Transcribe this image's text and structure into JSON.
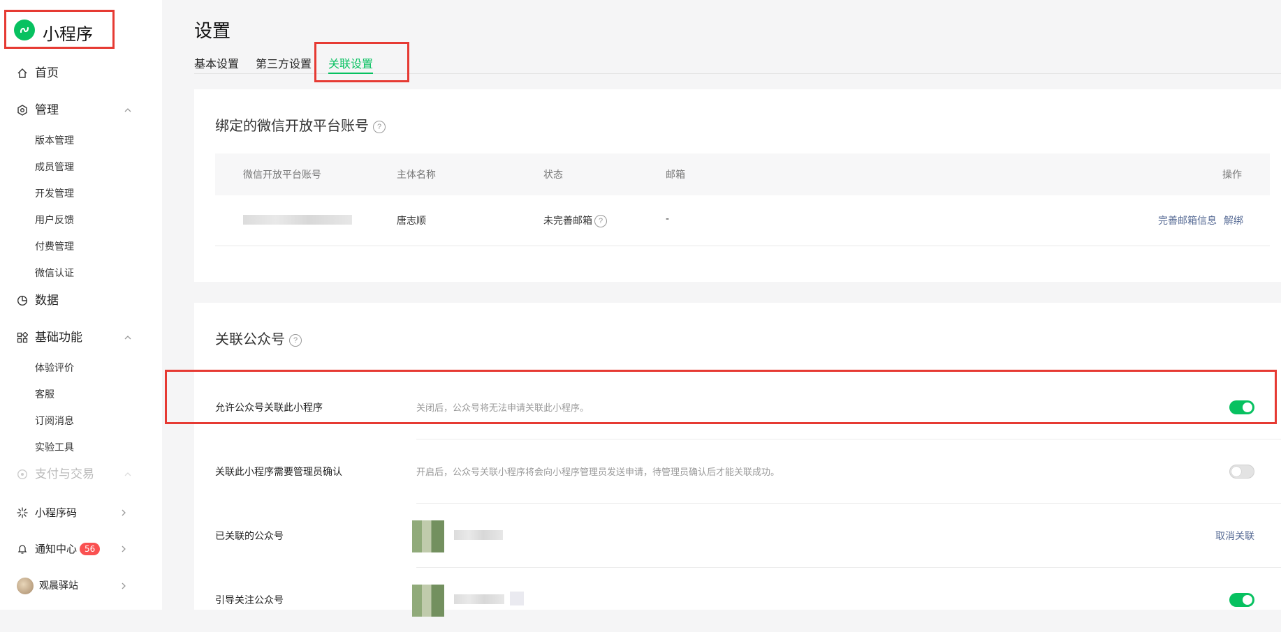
{
  "brand": {
    "title": "小程序",
    "logo_icon": "miniprogram-logo-icon",
    "color": "#07c160"
  },
  "sidebar": {
    "home": "首页",
    "manage": {
      "label": "管理",
      "items": [
        "版本管理",
        "成员管理",
        "开发管理",
        "用户反馈",
        "付费管理",
        "微信认证"
      ]
    },
    "data": "数据",
    "basic": {
      "label": "基础功能",
      "items": [
        "体验评价",
        "客服",
        "订阅消息",
        "实验工具"
      ]
    },
    "pay": "支付与交易",
    "qrcode": "小程序码",
    "notify": {
      "label": "通知中心",
      "count": "56"
    },
    "account": "观晨驿站"
  },
  "page": {
    "title": "设置",
    "tabs": [
      "基本设置",
      "第三方设置",
      "关联设置"
    ],
    "active_tab": "关联设置"
  },
  "open_platform": {
    "title": "绑定的微信开放平台账号",
    "columns": [
      "微信开放平台账号",
      "主体名称",
      "状态",
      "邮箱",
      "操作"
    ],
    "row": {
      "subject": "唐志顺",
      "status": "未完善邮箱",
      "email": "-",
      "actions": [
        "完善邮箱信息",
        "解绑"
      ]
    }
  },
  "official_account": {
    "title": "关联公众号",
    "settings": [
      {
        "label": "允许公众号关联此小程序",
        "desc": "关闭后，公众号将无法申请关联此小程序。",
        "enabled": true
      },
      {
        "label": "关联此小程序需要管理员确认",
        "desc": "开启后，公众号关联小程序将会向小程序管理员发送申请，待管理员确认后才能关联成功。",
        "enabled": false
      },
      {
        "label": "已关联的公众号",
        "action": "取消关联"
      },
      {
        "label": "引导关注公众号",
        "enabled": true
      }
    ]
  },
  "colors": {
    "accent": "#07c160",
    "link": "#576b95",
    "highlight": "#e63a33",
    "badge": "#fa5151"
  }
}
